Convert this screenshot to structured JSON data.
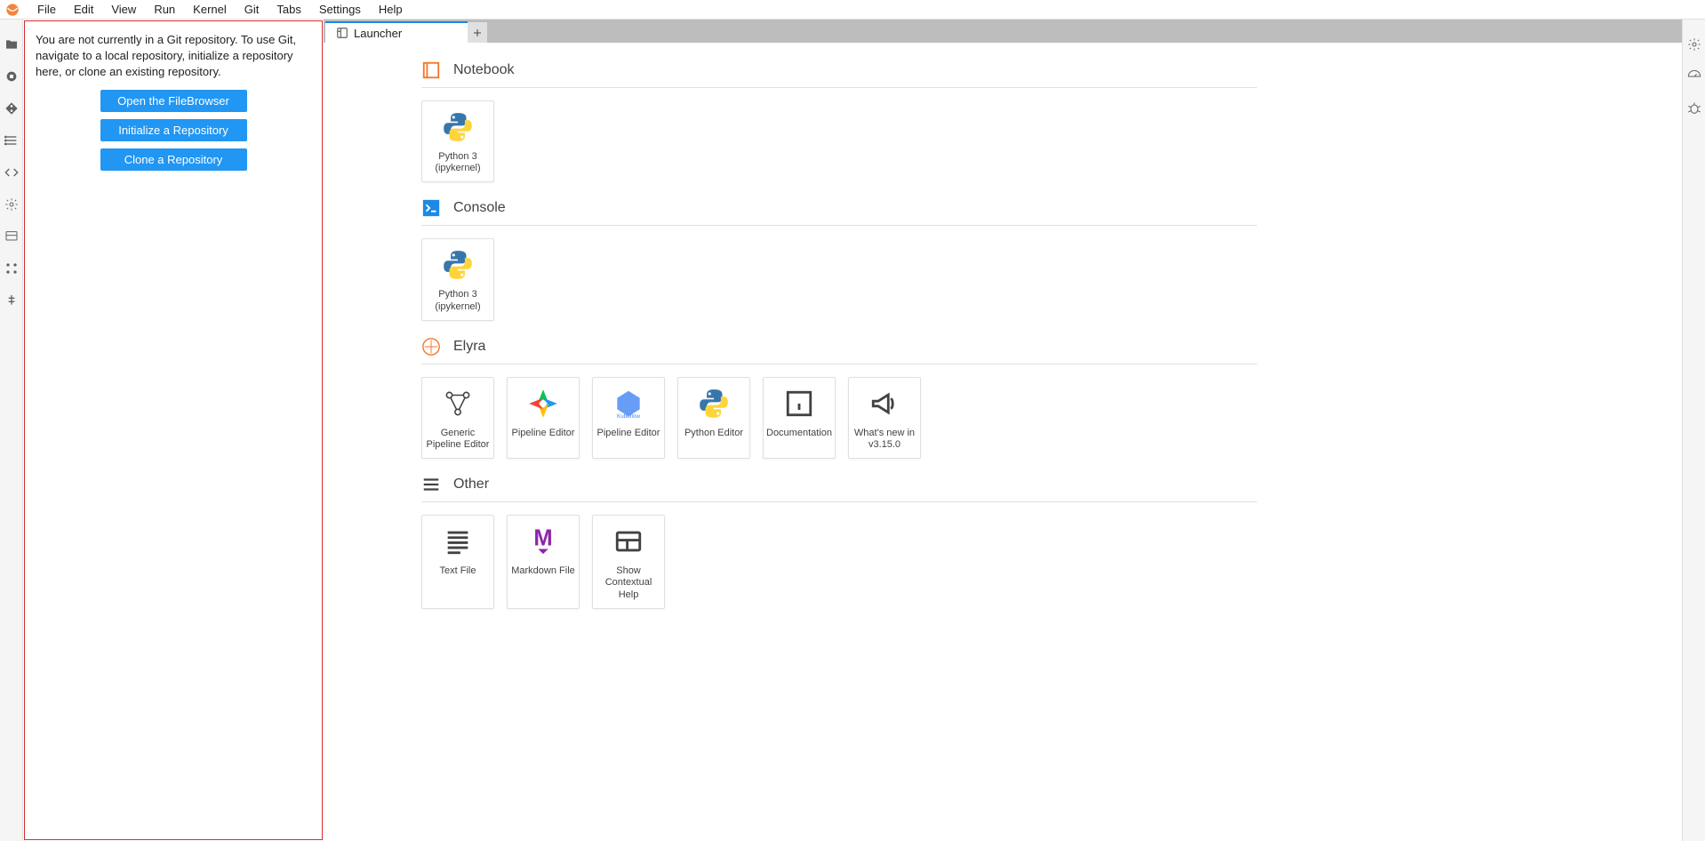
{
  "menubar": {
    "items": [
      "File",
      "Edit",
      "View",
      "Run",
      "Kernel",
      "Git",
      "Tabs",
      "Settings",
      "Help"
    ]
  },
  "left_panel": {
    "message": "You are not currently in a Git repository. To use Git, navigate to a local repository, initialize a repository here, or clone an existing repository.",
    "buttons": {
      "open_fb": "Open the FileBrowser",
      "init_repo": "Initialize a Repository",
      "clone_repo": "Clone a Repository"
    }
  },
  "tabs": {
    "active": {
      "label": "Launcher"
    }
  },
  "launcher": {
    "sections": {
      "notebook": {
        "title": "Notebook",
        "cards": [
          {
            "label": "Python 3 (ipykernel)"
          }
        ]
      },
      "console": {
        "title": "Console",
        "cards": [
          {
            "label": "Python 3 (ipykernel)"
          }
        ]
      },
      "elyra": {
        "title": "Elyra",
        "cards": [
          {
            "label": "Generic Pipeline Editor"
          },
          {
            "label": "Pipeline Editor"
          },
          {
            "label": "Pipeline Editor"
          },
          {
            "label": "Python Editor"
          },
          {
            "label": "Documentation"
          },
          {
            "label": "What's new in v3.15.0"
          }
        ]
      },
      "other": {
        "title": "Other",
        "cards": [
          {
            "label": "Text File"
          },
          {
            "label": "Markdown File"
          },
          {
            "label": "Show Contextual Help"
          }
        ]
      }
    }
  }
}
